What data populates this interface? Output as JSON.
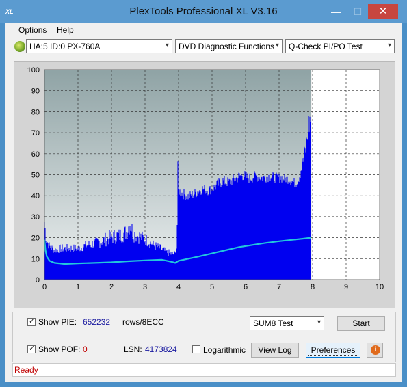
{
  "window": {
    "title": "PlexTools Professional XL V3.16",
    "icon_text": "XL",
    "min_glyph": "—",
    "max_glyph": "☐",
    "close_glyph": "✕"
  },
  "menu": {
    "options": "Options",
    "options_mnemonic": "O",
    "options_rest": "ptions",
    "help": "Help",
    "help_mnemonic": "H",
    "help_rest": "elp"
  },
  "toolbar": {
    "drive": "HA:5 ID:0  PX-760A",
    "function": "DVD Diagnostic Functions",
    "test": "Q-Check PI/PO Test",
    "arrow_glyph": "▾"
  },
  "chart_data": {
    "type": "bar",
    "xlim": [
      0,
      10
    ],
    "ylim": [
      0,
      100
    ],
    "x_ticks": [
      "0",
      "1",
      "2",
      "3",
      "4",
      "5",
      "6",
      "7",
      "8",
      "9",
      "10"
    ],
    "y_ticks": [
      "0",
      "10",
      "20",
      "30",
      "40",
      "50",
      "60",
      "70",
      "80",
      "90",
      "100"
    ],
    "grid": true,
    "background": "#9cb0b2",
    "bar_color": "#0000f0",
    "line_color": "#22c6dc",
    "x_end": 7.95,
    "pie_envelope": [
      [
        0.0,
        32
      ],
      [
        0.05,
        22
      ],
      [
        0.15,
        18
      ],
      [
        0.3,
        16
      ],
      [
        0.5,
        17
      ],
      [
        0.75,
        17
      ],
      [
        1.0,
        17
      ],
      [
        1.25,
        19
      ],
      [
        1.5,
        20
      ],
      [
        1.75,
        22
      ],
      [
        2.0,
        24
      ],
      [
        2.25,
        25
      ],
      [
        2.45,
        27
      ],
      [
        2.55,
        33
      ],
      [
        2.65,
        26
      ],
      [
        2.85,
        24
      ],
      [
        3.05,
        22
      ],
      [
        3.25,
        19
      ],
      [
        3.45,
        17
      ],
      [
        3.65,
        15
      ],
      [
        3.8,
        14
      ],
      [
        3.95,
        14
      ],
      [
        3.98,
        57
      ],
      [
        4.0,
        45
      ],
      [
        4.1,
        44
      ],
      [
        4.3,
        42
      ],
      [
        4.5,
        44
      ],
      [
        4.7,
        46
      ],
      [
        4.9,
        45
      ],
      [
        5.1,
        47
      ],
      [
        5.3,
        50
      ],
      [
        5.5,
        49
      ],
      [
        5.7,
        51
      ],
      [
        5.9,
        53
      ],
      [
        6.1,
        51
      ],
      [
        6.3,
        52
      ],
      [
        6.5,
        51
      ],
      [
        6.7,
        52
      ],
      [
        6.9,
        51
      ],
      [
        7.1,
        51
      ],
      [
        7.3,
        50
      ],
      [
        7.5,
        48
      ],
      [
        7.6,
        52
      ],
      [
        7.7,
        60
      ],
      [
        7.8,
        68
      ],
      [
        7.88,
        82
      ],
      [
        7.93,
        85
      ]
    ],
    "pie_baseline": [
      [
        0.0,
        12
      ],
      [
        0.05,
        10
      ],
      [
        0.15,
        8.5
      ],
      [
        0.3,
        7.5
      ],
      [
        0.5,
        7.5
      ],
      [
        0.75,
        7.5
      ],
      [
        1.0,
        7.5
      ],
      [
        1.25,
        7.5
      ],
      [
        1.5,
        7.5
      ],
      [
        1.75,
        7.5
      ],
      [
        2.0,
        7.5
      ],
      [
        2.25,
        7.5
      ],
      [
        2.5,
        7.5
      ],
      [
        2.75,
        8
      ],
      [
        3.0,
        8
      ],
      [
        3.25,
        8
      ],
      [
        3.5,
        7.5
      ],
      [
        3.7,
        6
      ],
      [
        3.9,
        6
      ],
      [
        4.0,
        34
      ],
      [
        4.1,
        32
      ],
      [
        4.3,
        31
      ],
      [
        4.5,
        32
      ],
      [
        4.7,
        34
      ],
      [
        4.9,
        34
      ],
      [
        5.1,
        35
      ],
      [
        5.3,
        37
      ],
      [
        5.5,
        37
      ],
      [
        5.7,
        38
      ],
      [
        5.9,
        40
      ],
      [
        6.1,
        39
      ],
      [
        6.3,
        40
      ],
      [
        6.5,
        40
      ],
      [
        6.7,
        40
      ],
      [
        6.9,
        40
      ],
      [
        7.1,
        40
      ],
      [
        7.3,
        40
      ],
      [
        7.5,
        38
      ],
      [
        7.7,
        40
      ],
      [
        7.93,
        46
      ]
    ],
    "avg_curve": [
      [
        0.0,
        19
      ],
      [
        0.03,
        14
      ],
      [
        0.07,
        11
      ],
      [
        0.15,
        9
      ],
      [
        0.3,
        8
      ],
      [
        0.6,
        7.5
      ],
      [
        1.0,
        7.8
      ],
      [
        1.5,
        8
      ],
      [
        2.0,
        8.3
      ],
      [
        2.5,
        8.8
      ],
      [
        3.0,
        9.2
      ],
      [
        3.5,
        9.5
      ],
      [
        3.8,
        8.5
      ],
      [
        3.9,
        8
      ],
      [
        4.0,
        9
      ],
      [
        4.3,
        10
      ],
      [
        4.6,
        11
      ],
      [
        5.0,
        12.5
      ],
      [
        5.4,
        14
      ],
      [
        5.8,
        15.5
      ],
      [
        6.2,
        16.5
      ],
      [
        6.6,
        17.5
      ],
      [
        7.0,
        18.3
      ],
      [
        7.4,
        19
      ],
      [
        7.7,
        19.5
      ],
      [
        7.95,
        20
      ]
    ]
  },
  "controls": {
    "show_pie_label": "Show PIE:",
    "show_pie_mnemonic": "I",
    "pie_value": "652232",
    "rows_label": "rows/8ECC",
    "show_poe_label": "Show POF:",
    "poe_value": "0",
    "lsn_label": "LSN:",
    "lsn_value": "4173824",
    "log_label": "Logarithmic",
    "sum8": "SUM8 Test",
    "start": "Start",
    "view_log": "View Log",
    "preferences": "Preferences",
    "info_glyph": "i",
    "check_glyph": "✓"
  },
  "status": {
    "text": "Ready"
  }
}
